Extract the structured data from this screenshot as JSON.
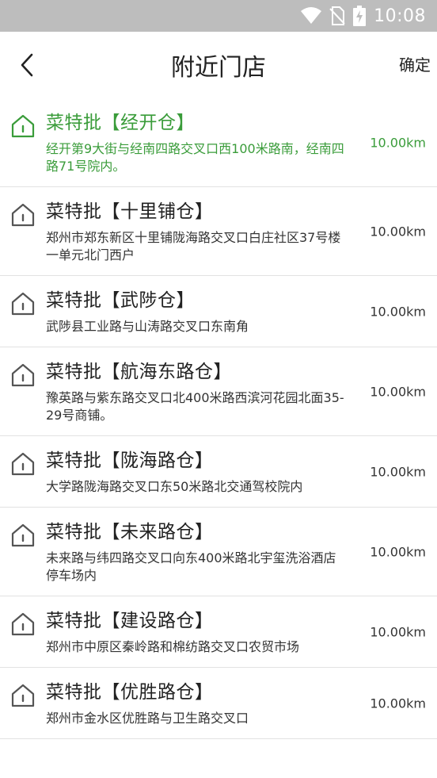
{
  "status_bar": {
    "time": "10:08",
    "icons": [
      "wifi-icon",
      "no-sim-icon",
      "battery-charging-icon"
    ]
  },
  "nav": {
    "title": "附近门店",
    "confirm_label": "确定",
    "back_icon": "chevron-left-icon"
  },
  "colors": {
    "selected": "#3a9c3a",
    "status_bar_bg": "#bdbdbd",
    "divider": "#e2e2e2"
  },
  "stores": [
    {
      "name": "菜特批【经开仓】",
      "address": "经开第9大街与经南四路交叉口西100米路南，经南四路71号院内。",
      "distance": "10.00km",
      "selected": true
    },
    {
      "name": "菜特批【十里铺仓】",
      "address": "郑州市郑东新区十里铺陇海路交叉口白庄社区37号楼一单元北门西户",
      "distance": "10.00km",
      "selected": false
    },
    {
      "name": "菜特批【武陟仓】",
      "address": "武陟县工业路与山涛路交叉口东南角",
      "distance": "10.00km",
      "selected": false
    },
    {
      "name": "菜特批【航海东路仓】",
      "address": "豫英路与紫东路交叉口北400米路西滨河花园北面35-29号商铺。",
      "distance": "10.00km",
      "selected": false
    },
    {
      "name": "菜特批【陇海路仓】",
      "address": "大学路陇海路交叉口东50米路北交通驾校院内",
      "distance": "10.00km",
      "selected": false
    },
    {
      "name": "菜特批【未来路仓】",
      "address": "未来路与纬四路交叉口向东400米路北宇玺洗浴酒店停车场内",
      "distance": "10.00km",
      "selected": false
    },
    {
      "name": "菜特批【建设路仓】",
      "address": "郑州市中原区秦岭路和棉纺路交叉口农贸市场",
      "distance": "10.00km",
      "selected": false
    },
    {
      "name": "菜特批【优胜路仓】",
      "address": "郑州市金水区优胜路与卫生路交叉口",
      "distance": "10.00km",
      "selected": false
    }
  ]
}
